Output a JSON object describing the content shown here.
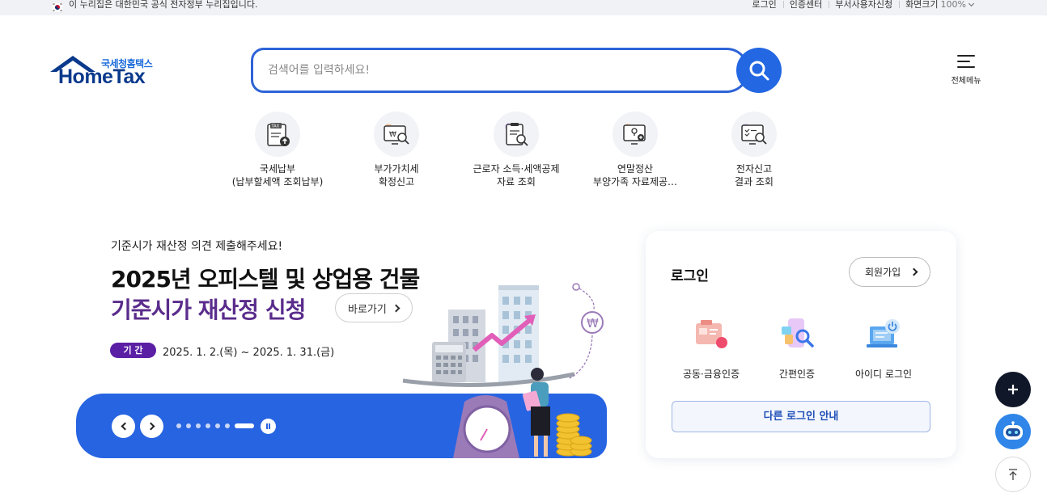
{
  "govbar": {
    "notice": "이 누리집은 대한민국 공식 전자정부 누리집입니다."
  },
  "utility": {
    "login": "로그인",
    "cert_center": "인증센터",
    "dept_user": "부서사용자신청",
    "zoom_label": "화면크기",
    "zoom_value": "100%"
  },
  "logo": {
    "kr": "국세청홈택스",
    "en": "HomeTax"
  },
  "search": {
    "placeholder": "검색어를 입력하세요!",
    "value": ""
  },
  "all_menu": {
    "label": "전체메뉴"
  },
  "quick_menu": [
    {
      "line1": "국세납부",
      "line2": "(납부할세액 조회납부)",
      "icon": "tax-payment-icon"
    },
    {
      "line1": "부가가치세",
      "line2": "확정신고",
      "icon": "vat-report-icon"
    },
    {
      "line1": "근로자 소득·세액공제",
      "line2": "자료 조회",
      "icon": "deduction-search-icon"
    },
    {
      "line1": "연말정산",
      "line2": "부양가족 자료제공…",
      "icon": "year-end-icon"
    },
    {
      "line1": "전자신고",
      "line2": "결과 조회",
      "icon": "e-report-result-icon"
    }
  ],
  "banner": {
    "subtitle": "기준시가 재산정 의견 제출해주세요!",
    "title_line1": "2025년 오피스텔 및 상업용 건물",
    "title_line2": "기준시가 재산정 신청",
    "go_label": "바로가기",
    "period_label": "기 간",
    "period_text": "2025. 1. 2.(목) ~ 2025. 1. 31.(금)",
    "slide_count": 7,
    "active_slide": 7
  },
  "login": {
    "title": "로그인",
    "join_label": "회원가입",
    "options": [
      {
        "label": "공동·금융인증",
        "icon": "certificate-icon"
      },
      {
        "label": "간편인증",
        "icon": "simple-auth-icon"
      },
      {
        "label": "아이디 로그인",
        "icon": "id-login-icon"
      }
    ],
    "other_label": "다른 로그인 안내"
  },
  "colors": {
    "brand_blue": "#2764e2",
    "banner_purple": "#5a2c8c",
    "navy": "#0b3a8c"
  }
}
